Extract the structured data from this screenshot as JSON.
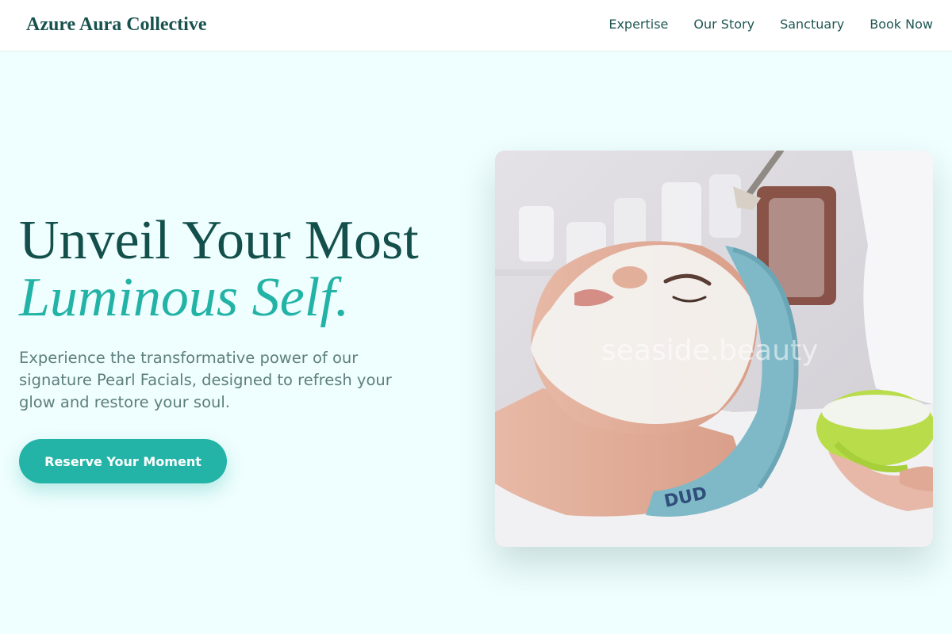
{
  "header": {
    "brand": "Azure Aura Collective",
    "nav": [
      {
        "label": "Expertise"
      },
      {
        "label": "Our Story"
      },
      {
        "label": "Sanctuary"
      },
      {
        "label": "Book Now"
      }
    ]
  },
  "hero": {
    "title_line1": "Unveil Your Most",
    "title_line2": "Luminous Self.",
    "subtitle": "Experience the transformative power of our signature Pearl Facials, designed to refresh your glow and restore your soul.",
    "cta_label": "Reserve Your Moment",
    "image": {
      "watermark": "seaside.beauty",
      "headband_text": "DUD"
    }
  },
  "colors": {
    "accent": "#22b3a6",
    "heading": "#14504b",
    "background": "#effefe",
    "button": "#23b4a7"
  }
}
